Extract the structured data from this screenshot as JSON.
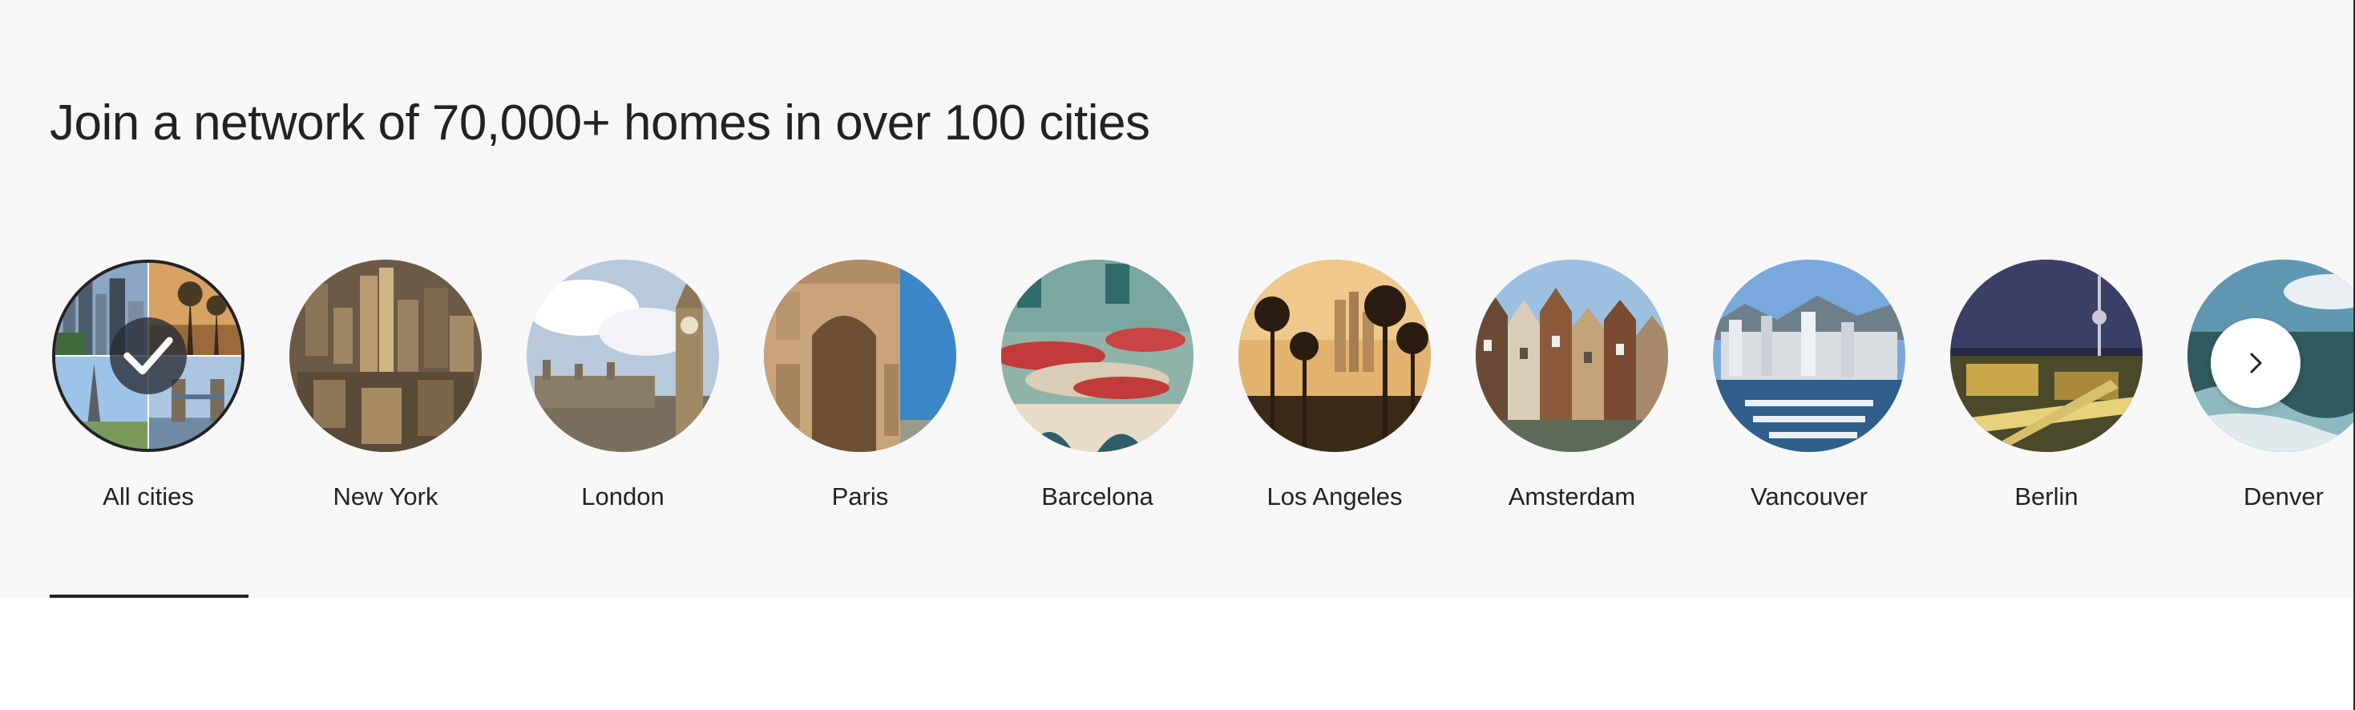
{
  "section": {
    "headline": "Join a network of 70,000+ homes in over 100 cities"
  },
  "cities": [
    {
      "label": "All cities",
      "selected": true
    },
    {
      "label": "New York",
      "selected": false
    },
    {
      "label": "London",
      "selected": false
    },
    {
      "label": "Paris",
      "selected": false
    },
    {
      "label": "Barcelona",
      "selected": false
    },
    {
      "label": "Los Angeles",
      "selected": false
    },
    {
      "label": "Amsterdam",
      "selected": false
    },
    {
      "label": "Vancouver",
      "selected": false
    },
    {
      "label": "Berlin",
      "selected": false
    },
    {
      "label": "Denver",
      "selected": false
    }
  ],
  "carousel": {
    "next_icon": "chevron-right-icon",
    "selected_icon": "checkmark-icon"
  },
  "colors": {
    "band_background": "#f7f7f7",
    "text": "#222222",
    "selected_ring": "#222222"
  }
}
